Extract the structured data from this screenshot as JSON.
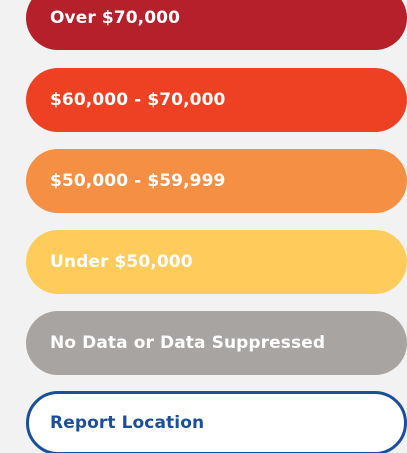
{
  "legend": {
    "items": [
      {
        "label": "Over $70,000",
        "color": "#b5202a"
      },
      {
        "label": "$60,000 - $70,000",
        "color": "#ee4124"
      },
      {
        "label": "$50,000 - $59,999",
        "color": "#f58f43"
      },
      {
        "label": "Under $50,000",
        "color": "#ffcc5c"
      },
      {
        "label": "No Data or Data Suppressed",
        "color": "#a7a4a2"
      }
    ],
    "report_location": {
      "label": "Report Location",
      "border_color": "#1b4f9c",
      "text_color": "#1b4f9c"
    }
  }
}
